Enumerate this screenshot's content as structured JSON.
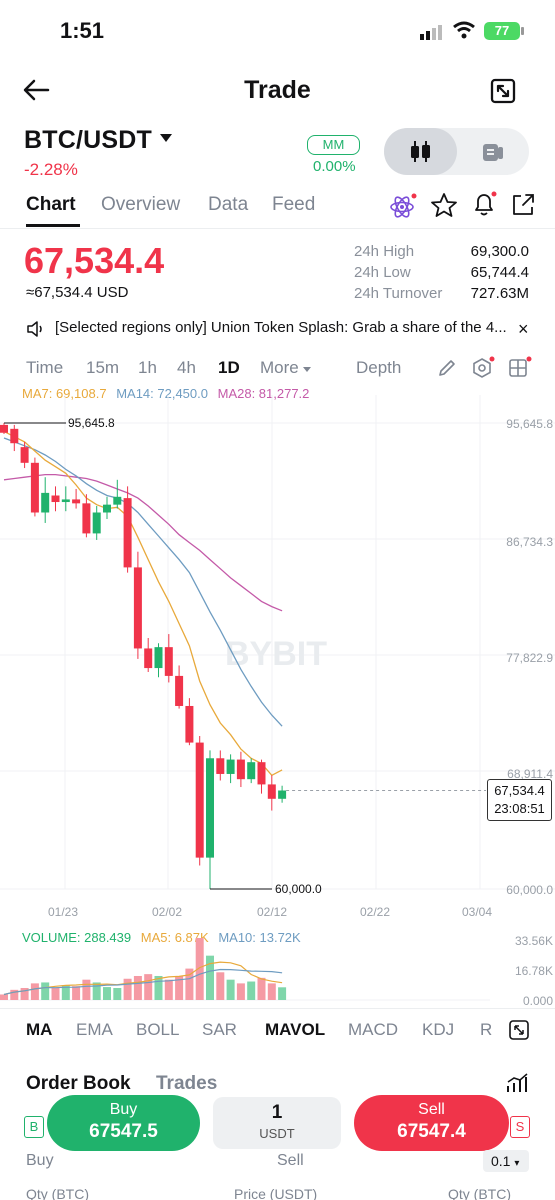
{
  "status_bar": {
    "time": "1:51",
    "battery": "77"
  },
  "topbar": {
    "title": "Trade"
  },
  "ticker": {
    "pair": "BTC/USDT",
    "change": "-2.28%",
    "mm_label": "MM",
    "mm_value": "0.00%",
    "last_price": "67,534.4",
    "usd_equiv": "≈67,534.4 USD"
  },
  "tabs": [
    {
      "label": "Chart",
      "active": true
    },
    {
      "label": "Overview",
      "active": false
    },
    {
      "label": "Data",
      "active": false
    },
    {
      "label": "Feed",
      "active": false
    }
  ],
  "stats": {
    "high_label": "24h High",
    "high": "69,300.0",
    "low_label": "24h Low",
    "low": "65,744.4",
    "turnover_label": "24h Turnover",
    "turnover": "727.63M"
  },
  "announcement": "[Selected regions only] Union Token Splash: Grab a share of the 4...",
  "timeframes": [
    {
      "label": "Time"
    },
    {
      "label": "15m"
    },
    {
      "label": "1h"
    },
    {
      "label": "4h"
    },
    {
      "label": "1D"
    },
    {
      "label": "More"
    },
    {
      "label": "Depth"
    }
  ],
  "ma_legend": {
    "ma7": "MA7: 69,108.7",
    "ma14": "MA14: 72,450.0",
    "ma28": "MA28: 81,277.2"
  },
  "vol_legend": {
    "volume": "VOLUME: 288.439",
    "ma5": "MA5: 6.87K",
    "ma10": "MA10: 13.72K"
  },
  "watermark": "BYBIT",
  "chart_data": {
    "type": "candlestick",
    "y_ticks": [
      "95,645.8",
      "86,734.3",
      "77,822.9",
      "68,911.4",
      "60,000.0"
    ],
    "x_ticks": [
      "01/23",
      "02/02",
      "02/12",
      "02/22",
      "03/04"
    ],
    "high_marker": "95,645.8",
    "low_marker": "60,000.0",
    "current_price": "67,534.4",
    "countdown": "23:08:51",
    "vol_ticks": [
      "33.56K",
      "16.78K",
      "0.000"
    ],
    "ylim": [
      60000,
      95645.8
    ],
    "candles": [
      {
        "o": 95500,
        "h": 95645.8,
        "l": 94800,
        "c": 94900
      },
      {
        "o": 95200,
        "h": 95500,
        "l": 93500,
        "c": 94100
      },
      {
        "o": 93800,
        "h": 94200,
        "l": 92200,
        "c": 92600
      },
      {
        "o": 92600,
        "h": 93000,
        "l": 88500,
        "c": 88800
      },
      {
        "o": 88800,
        "h": 91500,
        "l": 88000,
        "c": 90300
      },
      {
        "o": 90100,
        "h": 90800,
        "l": 88900,
        "c": 89600
      },
      {
        "o": 89600,
        "h": 90800,
        "l": 88900,
        "c": 89800
      },
      {
        "o": 89800,
        "h": 90600,
        "l": 89100,
        "c": 89500
      },
      {
        "o": 89500,
        "h": 90200,
        "l": 86900,
        "c": 87200
      },
      {
        "o": 87200,
        "h": 89300,
        "l": 86700,
        "c": 88800
      },
      {
        "o": 88800,
        "h": 90000,
        "l": 88300,
        "c": 89400
      },
      {
        "o": 89400,
        "h": 91300,
        "l": 89100,
        "c": 90000
      },
      {
        "o": 89900,
        "h": 90800,
        "l": 84200,
        "c": 84600
      },
      {
        "o": 84600,
        "h": 85800,
        "l": 77600,
        "c": 78400
      },
      {
        "o": 78400,
        "h": 79200,
        "l": 76600,
        "c": 76900
      },
      {
        "o": 76900,
        "h": 78800,
        "l": 76200,
        "c": 78500
      },
      {
        "o": 78500,
        "h": 79500,
        "l": 75800,
        "c": 76300
      },
      {
        "o": 76300,
        "h": 77100,
        "l": 73800,
        "c": 74000
      },
      {
        "o": 74000,
        "h": 74600,
        "l": 71000,
        "c": 71200
      },
      {
        "o": 71200,
        "h": 71700,
        "l": 61800,
        "c": 62400
      },
      {
        "o": 62400,
        "h": 70600,
        "l": 60000,
        "c": 70000
      },
      {
        "o": 70000,
        "h": 70600,
        "l": 68300,
        "c": 68800
      },
      {
        "o": 68800,
        "h": 70300,
        "l": 68100,
        "c": 69900
      },
      {
        "o": 69900,
        "h": 70500,
        "l": 67800,
        "c": 68400
      },
      {
        "o": 68400,
        "h": 70000,
        "l": 68100,
        "c": 69700
      },
      {
        "o": 69700,
        "h": 69900,
        "l": 67300,
        "c": 68000
      },
      {
        "o": 68000,
        "h": 68700,
        "l": 66000,
        "c": 66900
      },
      {
        "o": 66900,
        "h": 67900,
        "l": 66600,
        "c": 67534.4
      }
    ],
    "ma7": [
      95000,
      94600,
      94200,
      93500,
      92800,
      92300,
      91800,
      90900,
      89900,
      89400,
      89100,
      89200,
      88500,
      86900,
      85200,
      83500,
      82000,
      80300,
      78600,
      75900,
      74100,
      72700,
      71800,
      70700,
      70000,
      69600,
      68700,
      69108.7
    ],
    "ma14": [
      94500,
      94200,
      93900,
      93600,
      93200,
      92700,
      92100,
      91600,
      91000,
      90500,
      90100,
      89900,
      89500,
      88800,
      87900,
      87000,
      86100,
      85200,
      84200,
      82700,
      81200,
      79800,
      78300,
      76800,
      75500,
      74300,
      73300,
      72450
    ],
    "ma28": [
      91300,
      91400,
      91500,
      91600,
      91700,
      91700,
      91600,
      91500,
      91400,
      91200,
      90900,
      90600,
      90300,
      89900,
      89300,
      88600,
      87900,
      87100,
      86500,
      85900,
      85200,
      84500,
      83800,
      83200,
      82600,
      82000,
      81600,
      81277.2
    ],
    "volume": [
      3000,
      5500,
      6500,
      9000,
      9500,
      6500,
      8000,
      7500,
      11000,
      9500,
      7000,
      6500,
      11500,
      13000,
      14000,
      13000,
      11000,
      13000,
      17000,
      33560,
      24000,
      15000,
      11000,
      9000,
      10000,
      12000,
      9000,
      6870
    ]
  },
  "indicators": [
    {
      "label": "MA"
    },
    {
      "label": "EMA"
    },
    {
      "label": "BOLL"
    },
    {
      "label": "SAR"
    },
    {
      "label": "MAVOL"
    },
    {
      "label": "MACD"
    },
    {
      "label": "KDJ"
    },
    {
      "label": "R"
    }
  ],
  "order_book": {
    "tab1": "Order Book",
    "tab2": "Trades"
  },
  "actions": {
    "buy_label": "Buy",
    "buy_price": "67547.5",
    "qty": "1",
    "qty_unit": "USDT",
    "sell_label": "Sell",
    "sell_price": "67547.4"
  },
  "footer": {
    "buy": "Buy",
    "sell": "Sell",
    "step": "0.1",
    "col1": "Qty (BTC)",
    "col2": "Price (USDT)",
    "col3": "Qty (BTC)"
  },
  "colors": {
    "up": "#20b26c",
    "down": "#f0344a",
    "ma7": "#e8a93b",
    "ma14": "#6e9cc1",
    "ma28": "#c45aa8"
  }
}
